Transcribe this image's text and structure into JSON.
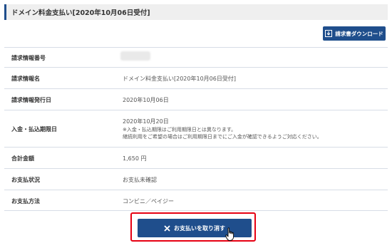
{
  "header": {
    "title": "ドメイン料金支払い[2020年10月06日受付]"
  },
  "download_button": {
    "label": "請求書ダウンロード",
    "icon": "download-icon"
  },
  "rows": [
    {
      "label": "請求情報番号",
      "value": ""
    },
    {
      "label": "請求情報名",
      "value": "ドメイン料金支払い[2020年10月06日受付]"
    },
    {
      "label": "請求情報発行日",
      "value": "2020年10月06日"
    },
    {
      "label": "入金・払込期限日",
      "value": "2020年10月20日",
      "notes": [
        "※入金・払込期限はご利用期限日とは異なります。",
        "継続利用をご希望の場合はご利用期限日までにご入金が確認できるようご対応ください。"
      ]
    },
    {
      "label": "合計金額",
      "value": "1,650 円"
    },
    {
      "label": "お支払状況",
      "value": "お支払未確認"
    },
    {
      "label": "お支払方法",
      "value": "コンビニ／ペイジー"
    }
  ],
  "cancel_button": {
    "label": "お支払いを取り消す",
    "icon": "close-icon"
  },
  "colors": {
    "primary": "#1f4e8c",
    "highlight": "#e60012",
    "divider": "#d7dde6"
  }
}
